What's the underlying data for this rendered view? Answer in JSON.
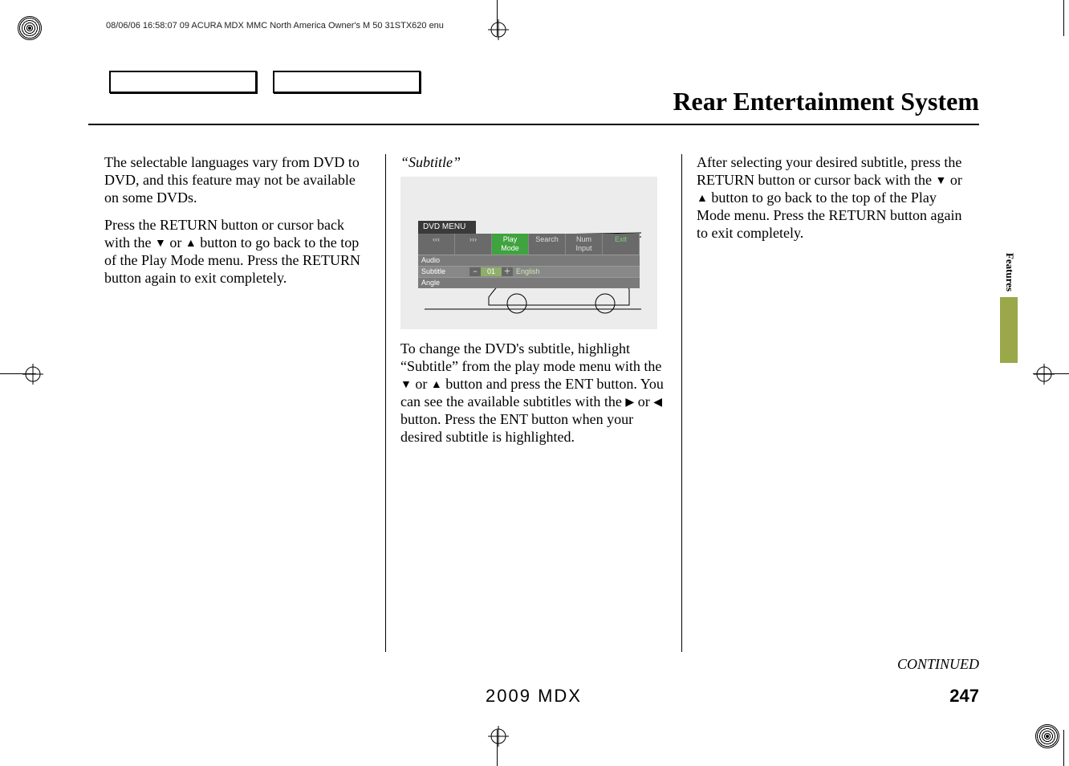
{
  "meta": {
    "header_line": "08/06/06 16:58:07   09 ACURA MDX MMC North America Owner's M 50 31STX620 enu"
  },
  "page": {
    "section_title": "Rear Entertainment System",
    "sidebar_label": "Features",
    "continued": "CONTINUED",
    "footer_model": "2009  MDX",
    "page_number": "247"
  },
  "col1": {
    "p1": "The selectable languages vary from DVD to DVD, and this feature may not be available on some DVDs.",
    "p2a": "Press the RETURN button or cursor back with the ",
    "p2b": " or ",
    "p2c": " button to go back to the top of the Play Mode menu. Press the RETURN button again to exit completely."
  },
  "col2": {
    "heading": "“Subtitle”",
    "screenshot": {
      "title": "DVD MENU",
      "tabs": {
        "a": "‹‹‹",
        "b": "›››",
        "active": "Play Mode",
        "c": "Search",
        "d": "Num Input",
        "exit": "Exit"
      },
      "rows": {
        "audio": "Audio",
        "subtitle": "Subtitle",
        "subtitle_val": "01",
        "subtitle_lang": "English",
        "angle": "Angle"
      }
    },
    "p1a": "To change the DVD's subtitle, highlight “Subtitle” from the play mode menu with the ",
    "p1b": " or ",
    "p1c": " button and press the ENT button. You can see the available subtitles with the ",
    "p1d": " or ",
    "p1e": " button. Press the ENT button when your desired subtitle is highlighted."
  },
  "col3": {
    "p1a": "After selecting your desired subtitle, press the RETURN button or cursor back with the ",
    "p1b": " or ",
    "p1c": " button to go back to the top of the Play Mode menu. Press the RETURN button again to exit completely."
  },
  "glyphs": {
    "down": "▼",
    "up": "▲",
    "right": "▶",
    "left": "◀",
    "minus": "−",
    "plus": "＋"
  }
}
